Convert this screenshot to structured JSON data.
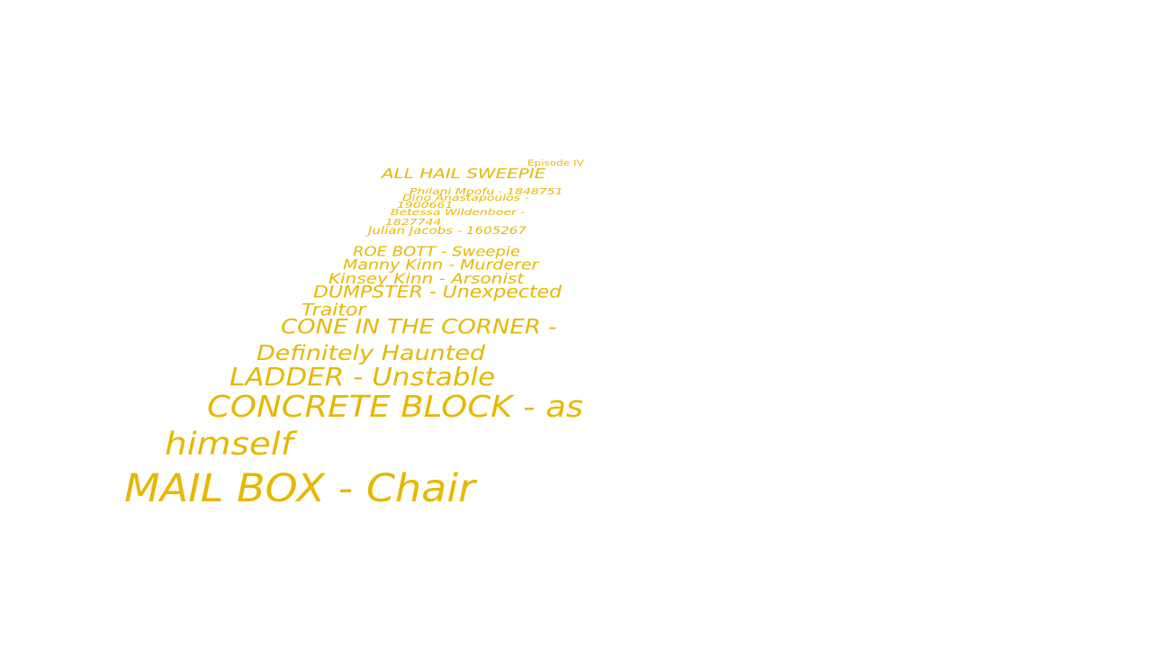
{
  "crawl": {
    "color": "#e6b800",
    "episode": "Episode IV",
    "title": "ALL HAIL SWEEPIE",
    "authors": [
      "Philani Mpofu - 1848751",
      "Dino      Anastapoulos      -",
      "1900661",
      "Betessa      Wildenboer      -",
      "1827744",
      "Julian Jacobs - 1605267"
    ],
    "cast": [
      "ROE BOTT - Sweepie",
      "Manny Kinn - Murderer",
      "Kinsey Kinn - Arsonist",
      "DUMPSTER    -    Unexpected",
      "Traitor",
      "CONE   IN   THE   CORNER   -",
      "Definitely Haunted",
      "LADDER - Unstable",
      "CONCRETE     BLOCK     -     as",
      "himself",
      "MAIL BOX - Chair"
    ]
  }
}
